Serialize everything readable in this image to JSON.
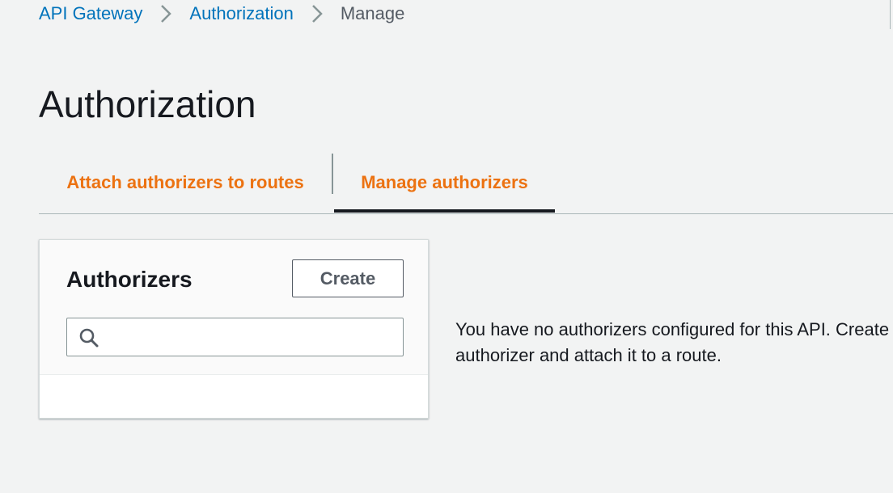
{
  "breadcrumb": {
    "items": [
      {
        "label": "API Gateway"
      },
      {
        "label": "Authorization"
      },
      {
        "label": "Manage"
      }
    ]
  },
  "page": {
    "title": "Authorization"
  },
  "tabs": [
    {
      "label": "Attach authorizers to routes",
      "active": false
    },
    {
      "label": "Manage authorizers",
      "active": true
    }
  ],
  "authorizers_panel": {
    "title": "Authorizers",
    "create_label": "Create",
    "search": {
      "value": "",
      "placeholder": "",
      "icon": "search-icon"
    }
  },
  "empty_state": {
    "message": "You have no authorizers configured for this API. Create an authorizer and attach it to a route."
  },
  "colors": {
    "link": "#0073bb",
    "tab_text": "#ec7211",
    "background": "#f2f3f3",
    "active_tab_indicator": "#16191f"
  }
}
